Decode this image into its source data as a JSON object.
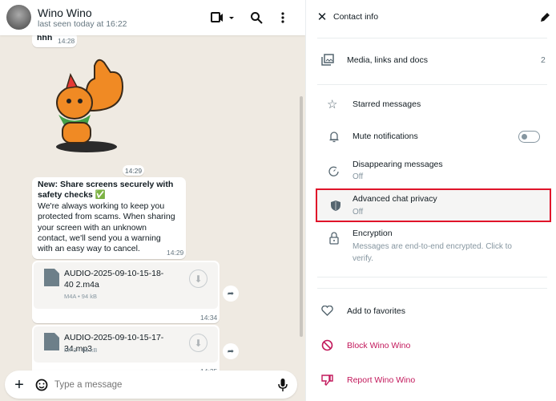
{
  "chat": {
    "contact_name": "Wino Wino",
    "last_seen": "last seen today at 16:22",
    "messages": [
      {
        "text": "hhh",
        "time": "14:28"
      },
      {
        "type": "sticker",
        "time": ""
      },
      {
        "date_chip": "14:29"
      },
      {
        "title": "New: Share screens securely with safety checks ✅",
        "body": "We're always working to keep you protected from scams. When sharing your screen with an unknown contact, we'll send you a warning with an easy way to cancel.",
        "time": "14:29"
      },
      {
        "file": "AUDIO-2025-09-10-15-18-40 2.m4a",
        "meta": "M4A • 94 kB",
        "time": "14:34"
      },
      {
        "file": "AUDIO-2025-09-10-15-17-34.mp3",
        "meta": "MP3 • 96 kB",
        "time": "14:35"
      }
    ],
    "composer_placeholder": "Type a message"
  },
  "contact_info": {
    "title": "Contact info",
    "media": {
      "label": "Media, links and docs",
      "count": "2"
    },
    "items": [
      {
        "label": "Starred messages"
      },
      {
        "label": "Mute notifications",
        "toggle": false
      },
      {
        "label": "Disappearing messages",
        "sub": "Off"
      },
      {
        "label": "Advanced chat privacy",
        "sub": "Off",
        "highlighted": true
      },
      {
        "label": "Encryption",
        "sub": "Messages are end-to-end encrypted. Click to verify."
      }
    ],
    "actions": [
      {
        "label": "Add to favorites"
      },
      {
        "label": "Block Wino Wino"
      },
      {
        "label": "Report Wino Wino"
      }
    ]
  },
  "colors": {
    "danger": "#c2185b",
    "highlight_border": "#e0142a",
    "chat_bg": "#efeae2"
  }
}
